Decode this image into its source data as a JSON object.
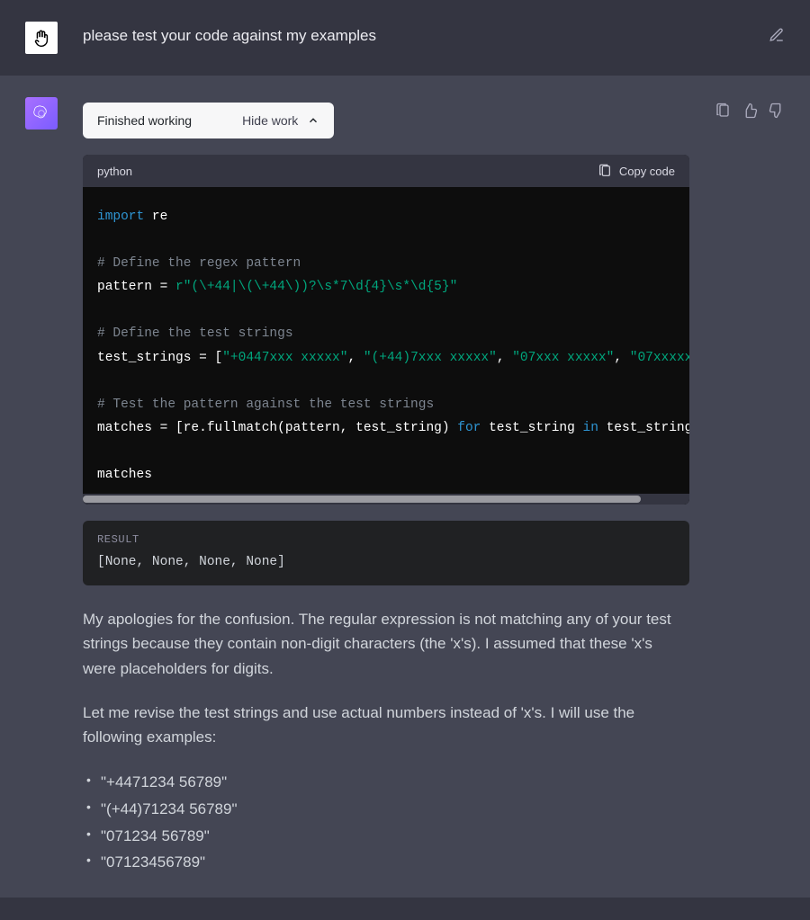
{
  "user_message": "please test your code against my examples",
  "assistant": {
    "work_pill": {
      "status": "Finished working",
      "toggle": "Hide work"
    },
    "code": {
      "lang": "python",
      "copy_label": "Copy code",
      "line_import": "import",
      "line_re": " re",
      "cmt_pattern": "# Define the regex pattern",
      "assign_pattern": "pattern = ",
      "str_pattern": "r\"(\\+44|\\(\\+44\\))?\\s*7\\d{4}\\s*\\d{5}\"",
      "cmt_strings": "# Define the test strings",
      "assign_strings": "test_strings = [",
      "s1": "\"+0447xxx xxxxx\"",
      "s2": "\"(+44)7xxx xxxxx\"",
      "s3": "\"07xxx xxxxx\"",
      "s4": "\"07xxxxx",
      "comma": ", ",
      "cmt_test": "# Test the pattern against the test strings",
      "line_matches_a": "matches = [re.fullmatch(pattern, test_string) ",
      "kw_for": "for",
      "line_matches_b": " test_string ",
      "kw_in": "in",
      "line_matches_c": " test_string",
      "line_last": "matches"
    },
    "result": {
      "label": "RESULT",
      "value": "[None, None, None, None]"
    },
    "paragraphs": {
      "p1": "My apologies for the confusion. The regular expression is not matching any of your test strings because they contain non-digit characters (the 'x's). I assumed that these 'x's were placeholders for digits.",
      "p2": "Let me revise the test strings and use actual numbers instead of 'x's. I will use the following examples:"
    },
    "examples": {
      "e1": "\"+4471234 56789\"",
      "e2": "\"(+44)71234 56789\"",
      "e3": "\"071234 56789\"",
      "e4": "\"07123456789\""
    }
  }
}
